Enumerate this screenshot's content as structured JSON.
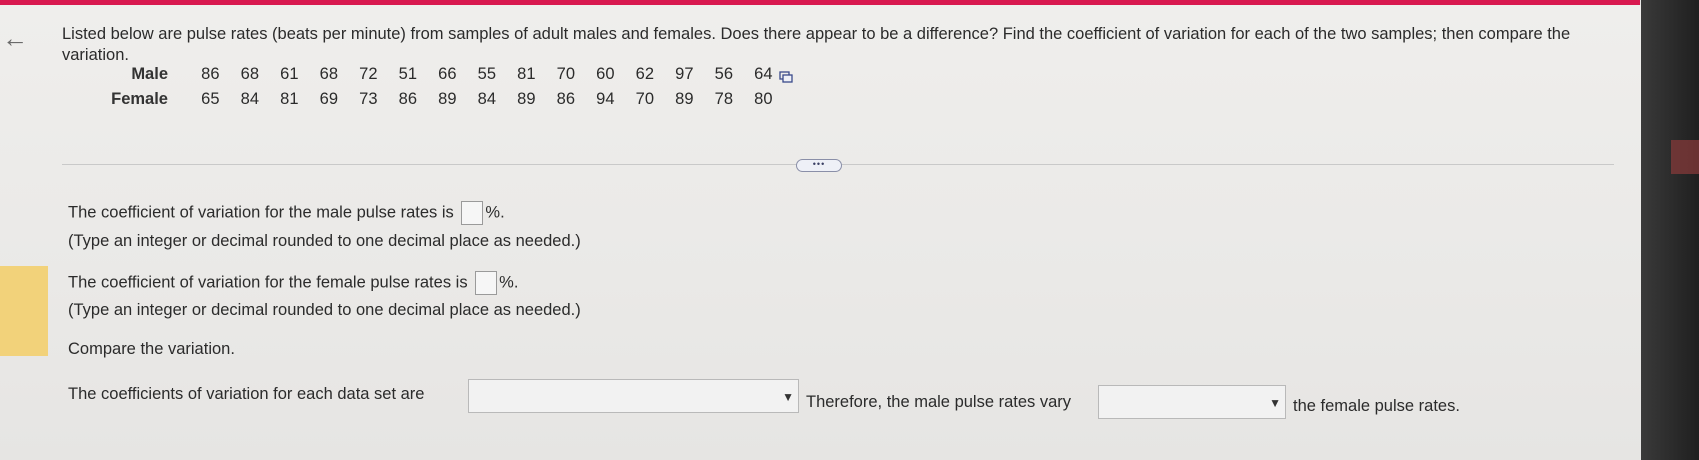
{
  "question": {
    "text": "Listed below are pulse rates (beats per minute) from samples of adult males and females. Does there appear to be a difference? Find the coefficient of variation for each of the two samples; then compare the variation."
  },
  "table": {
    "rows": [
      {
        "label": "Male",
        "values": [
          "86",
          "68",
          "61",
          "68",
          "72",
          "51",
          "66",
          "55",
          "81",
          "70",
          "60",
          "62",
          "97",
          "56",
          "64"
        ]
      },
      {
        "label": "Female",
        "values": [
          "65",
          "84",
          "81",
          "69",
          "73",
          "86",
          "89",
          "84",
          "89",
          "86",
          "94",
          "70",
          "89",
          "78",
          "80"
        ]
      }
    ]
  },
  "more_button": {
    "label": "•••"
  },
  "part1": {
    "prompt_before": "The coefficient of variation for the male pulse rates is",
    "prompt_after": "%.",
    "hint": "(Type an integer or decimal rounded to one decimal place as needed.)",
    "value": ""
  },
  "part2": {
    "prompt_before": "The coefficient of variation for the female pulse rates is",
    "prompt_after": "%.",
    "hint": "(Type an integer or decimal rounded to one decimal place as needed.)",
    "value": ""
  },
  "compare": {
    "label": "Compare the variation.",
    "sentence_part1": "The coefficients of variation for each data set are",
    "sentence_part2": "Therefore, the male pulse rates vary",
    "sentence_part3": "the female pulse rates.",
    "dropdown1_value": "",
    "dropdown2_value": ""
  },
  "icons": {
    "back": "back-arrow-icon",
    "copy": "copy-icon",
    "dropdown": "triangle-down"
  },
  "colors": {
    "accent": "#d8184f",
    "highlight": "#f2d27a"
  }
}
